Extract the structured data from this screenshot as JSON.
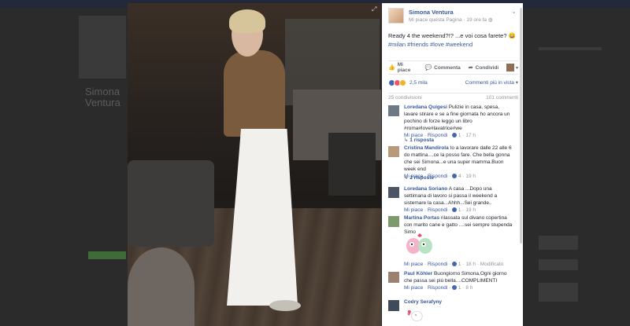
{
  "post": {
    "author": "Simona Ventura",
    "like_page": "Mi piace questa Pagina",
    "time": "19 ore fa",
    "text": "Ready 4 the weekend?!? ...e voi cosa farete? 😀",
    "tags": "#milan #friends #love #weekend"
  },
  "actions": {
    "like": "Mi piace",
    "comment": "Commenta",
    "share": "Condividi"
  },
  "reactions": {
    "count": "2,5 mila",
    "order": "Commenti più in vista"
  },
  "counts": {
    "shares": "25 condivisioni",
    "comments": "101 commenti"
  },
  "comments": [
    {
      "name": "Loredana Quigesi",
      "text": "Pulizie in casa, spesa, lavare stirare e se a fine giornata ho ancora un pochino di forze leggo un libro #roma#love#lavatrice#we",
      "like": "Mi piace",
      "reply": "Rispondi",
      "likes": "1",
      "time": "17 h",
      "replies": "1 risposta"
    },
    {
      "name": "Cristina Mandirola",
      "text": "Io a lavorare dalle 22 alle 6 do mattina....ce la posso fare. Che bella gonna che sei Simona...e una super mamma.Buon week end",
      "like": "Mi piace",
      "reply": "Rispondi",
      "likes": "4",
      "time": "19 h",
      "replies": "2 risposte"
    },
    {
      "name": "Loredana Soriano",
      "text": "A casa ...Dopo una settimana di lavoro si passa il weekend a sistemare la casa...Ahhh...Sei grande..",
      "like": "Mi piace",
      "reply": "Rispondi",
      "likes": "1",
      "time": "19 h"
    },
    {
      "name": "Martina Portas",
      "text": "rilassata sul divano copertina con marito cane e gatto ....sei sempre stupenda Simo",
      "like": "Mi piace",
      "reply": "Rispondi",
      "likes": "1",
      "time": "18 h",
      "edited": "Modificato"
    },
    {
      "name": "Paul Köhler",
      "text": "Buongiorno Simona,Ogni giorno che passa sei più bella....COMPLIMENTI",
      "like": "Mi piace",
      "reply": "Rispondi",
      "likes": "1",
      "time": "8 h"
    },
    {
      "name": "Codry Serafyny"
    }
  ],
  "bg": {
    "left_text": "Simona Ventura"
  }
}
